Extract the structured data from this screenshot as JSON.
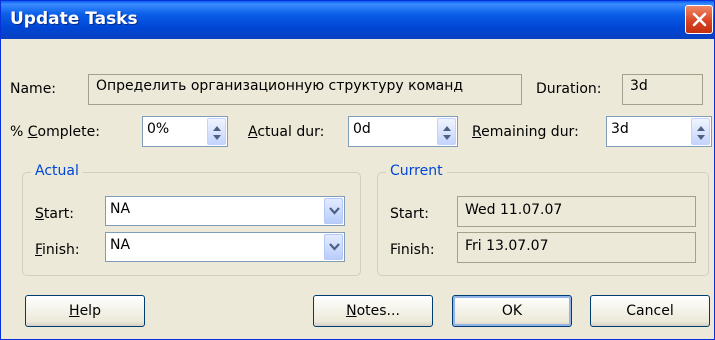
{
  "window": {
    "title": "Update Tasks"
  },
  "name": {
    "label": "Name:",
    "value": "Определить организационную структуру команд"
  },
  "duration": {
    "label": "Duration:",
    "value": "3d"
  },
  "percent_complete": {
    "label_prefix": "% ",
    "label_mnemonic": "C",
    "label_rest": "omplete:",
    "value": "0%"
  },
  "actual_dur": {
    "label_mnemonic": "A",
    "label_rest": "ctual dur:",
    "value": "0d"
  },
  "remaining_dur": {
    "label_mnemonic": "R",
    "label_rest": "emaining dur:",
    "value": "3d"
  },
  "actual_group": {
    "title": "Actual",
    "start": {
      "label_mnemonic": "S",
      "label_rest": "tart:",
      "value": "NA"
    },
    "finish": {
      "label_mnemonic": "F",
      "label_rest": "inish:",
      "value": "NA"
    }
  },
  "current_group": {
    "title": "Current",
    "start": {
      "label": "Start:",
      "value": "Wed 11.07.07"
    },
    "finish": {
      "label": "Finish:",
      "value": "Fri 13.07.07"
    }
  },
  "buttons": {
    "help": {
      "mnemonic": "H",
      "rest": "elp"
    },
    "notes": {
      "mnemonic": "N",
      "rest": "otes..."
    },
    "ok": {
      "label": "OK"
    },
    "cancel": {
      "label": "Cancel"
    }
  }
}
